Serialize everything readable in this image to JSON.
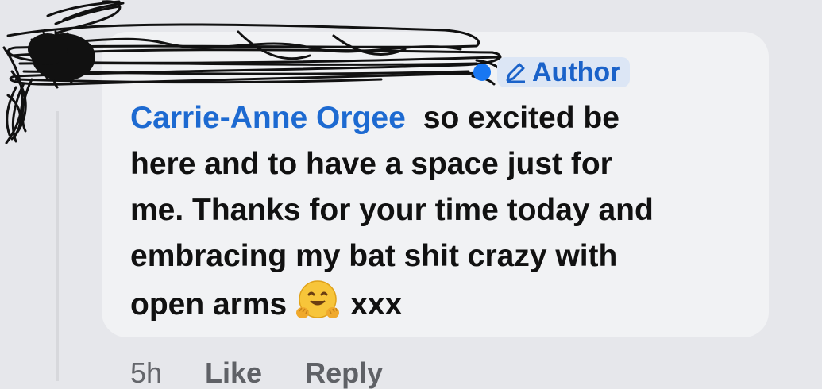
{
  "comment": {
    "badge": {
      "verified_icon": "verified-badge-icon",
      "edit_icon": "pencil-icon",
      "label": "Author"
    },
    "mention": "Carrie-Anne Orgee",
    "lines": [
      "so excited be",
      "here and to have a space just for",
      "me. Thanks for your time today and",
      "embracing my bat shit crazy with",
      "open arms"
    ],
    "emoji": "hugging-face",
    "trailing": "xxx"
  },
  "actions": {
    "timestamp": "5h",
    "like": "Like",
    "reply": "Reply"
  },
  "colors": {
    "background": "#e6e7eb",
    "bubble": "#f1f2f4",
    "link": "#1d6ad1",
    "text": "#111111"
  }
}
